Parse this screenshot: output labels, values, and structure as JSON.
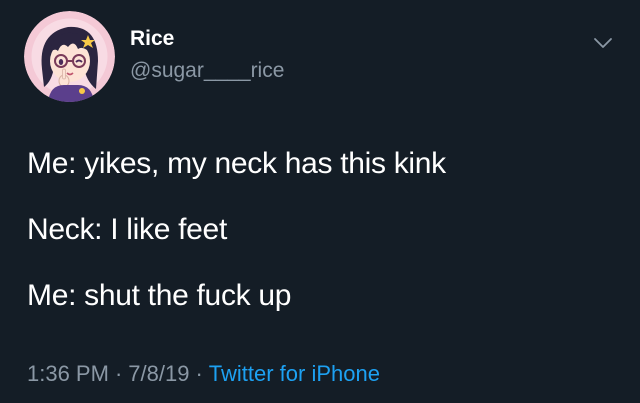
{
  "author": {
    "name": "Rice",
    "handle": "@sugar____rice",
    "avatar_icon": "anime-girl-avatar-icon"
  },
  "menu": {
    "icon": "chevron-down-icon"
  },
  "tweet": {
    "lines": [
      "Me: yikes, my neck has this kink",
      "Neck: I like feet",
      "Me: shut the fuck up"
    ]
  },
  "meta": {
    "time": "1:36 PM",
    "separator": "·",
    "date": "7/8/19",
    "source": "Twitter for iPhone"
  },
  "colors": {
    "background": "#141d26",
    "primary_text": "#ffffff",
    "secondary_text": "#8b98a5",
    "link": "#1da1f2"
  }
}
